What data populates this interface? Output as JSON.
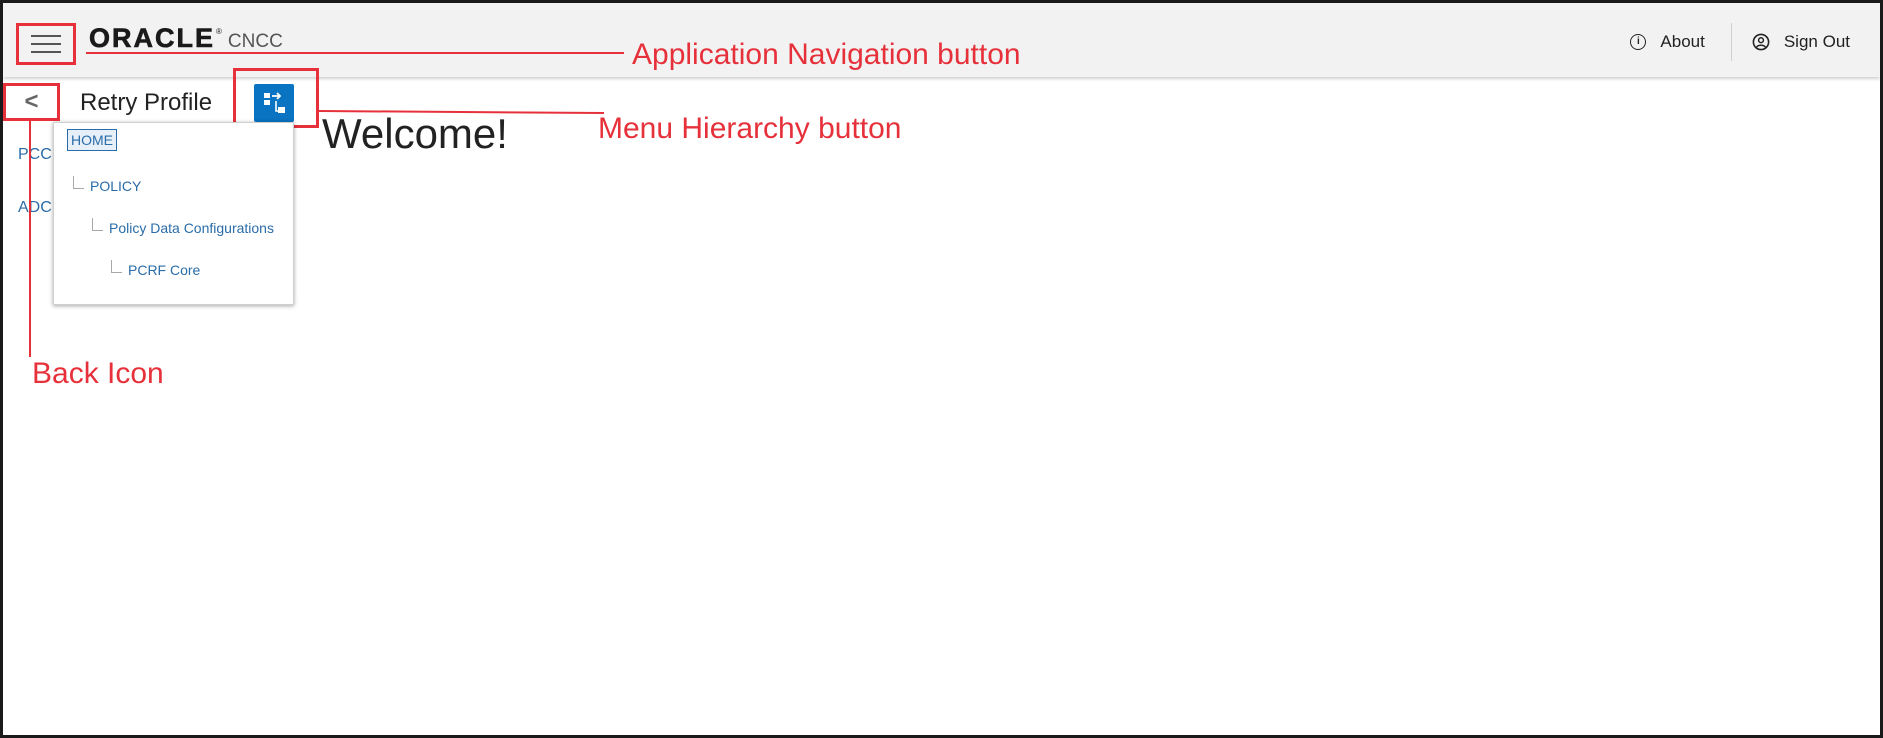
{
  "header": {
    "logo_word": "ORACLE",
    "logo_reg": "®",
    "app_name": "CNCC",
    "about_label": "About",
    "signout_label": "Sign Out",
    "about_icon_glyph": "i",
    "user_icon": "user-circle-icon"
  },
  "toolbar": {
    "back_glyph": "<",
    "title": "Retry Profile",
    "hierarchy_icon": "menu-hierarchy-icon"
  },
  "sidebar": {
    "items": [
      {
        "label": "PCC"
      },
      {
        "label": "ADC"
      }
    ]
  },
  "hierarchy": {
    "items": [
      {
        "label": "HOME"
      },
      {
        "label": "POLICY"
      },
      {
        "label": "Policy Data Configurations"
      },
      {
        "label": "PCRF Core"
      }
    ]
  },
  "main": {
    "welcome": "Welcome!"
  },
  "annotations": {
    "app_nav": "Application Navigation button",
    "menu_hierarchy": "Menu Hierarchy button",
    "back_icon": "Back Icon"
  },
  "colors": {
    "accent": "#0a73c2",
    "annotation": "#e6313b",
    "link": "#2a6ca8",
    "header_bg": "#f2f2f2"
  }
}
